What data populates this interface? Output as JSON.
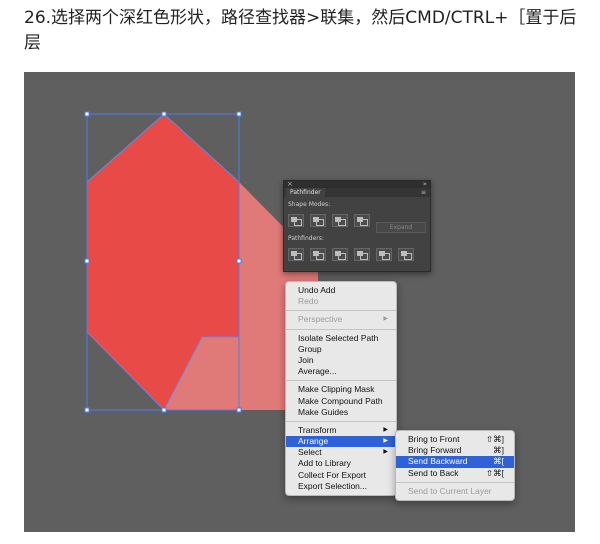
{
  "caption": "26.选择两个深红色形状，路径查找器>联集，然后CMD/CTRL+［置于后层",
  "colors": {
    "canvas": "#5f5f5f",
    "shape_dark": "#e84a47",
    "shape_light": "#e07a78",
    "highlight": "#2f62d6",
    "selection": "#4a7df0"
  },
  "pathfinder": {
    "tab": "Pathfinder",
    "shape_modes_label": "Shape Modes:",
    "pathfinders_label": "Pathfinders:",
    "expand_label": "Expand",
    "close_glyph": "×",
    "collapse_glyph": "»",
    "menu_glyph": "≡"
  },
  "context_menu": {
    "items": [
      {
        "label": "Undo Add"
      },
      {
        "label": "Redo"
      },
      {
        "label": "Perspective"
      },
      {
        "label": "Isolate Selected Path"
      },
      {
        "label": "Group"
      },
      {
        "label": "Join"
      },
      {
        "label": "Average..."
      },
      {
        "label": "Make Clipping Mask"
      },
      {
        "label": "Make Compound Path"
      },
      {
        "label": "Make Guides"
      },
      {
        "label": "Transform"
      },
      {
        "label": "Arrange"
      },
      {
        "label": "Select"
      },
      {
        "label": "Add to Library"
      },
      {
        "label": "Collect For Export"
      },
      {
        "label": "Export Selection..."
      }
    ],
    "submenu_arrow": "▶"
  },
  "arrange_submenu": {
    "items": [
      {
        "label": "Bring to Front",
        "shortcut": "⇧⌘]"
      },
      {
        "label": "Bring Forward",
        "shortcut": "⌘]"
      },
      {
        "label": "Send Backward",
        "shortcut": "⌘["
      },
      {
        "label": "Send to Back",
        "shortcut": "⇧⌘["
      },
      {
        "label": "Send to Current Layer",
        "shortcut": ""
      }
    ]
  }
}
